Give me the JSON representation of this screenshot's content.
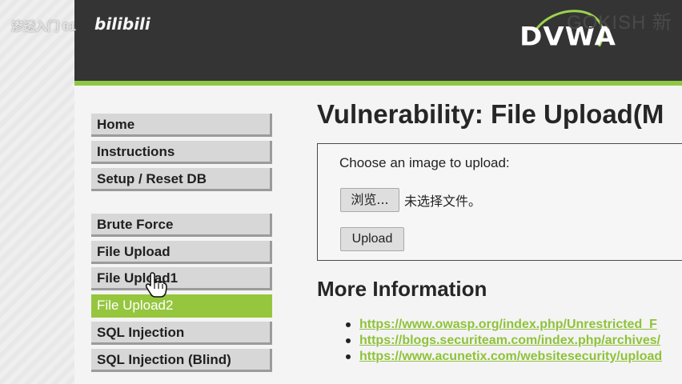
{
  "overlay": {
    "watermark_left": "渗透入门 01",
    "watermark_bilibili": "bilibili",
    "watermark_right": "GOKISH 新"
  },
  "header": {
    "logo_text": "DVWA",
    "brand_color": "#8fc744"
  },
  "menu": {
    "items": [
      {
        "label": "Home"
      },
      {
        "label": "Instructions"
      },
      {
        "label": "Setup / Reset DB"
      },
      {
        "label": "Brute Force"
      },
      {
        "label": "File Upload"
      },
      {
        "label": "File Upload1"
      },
      {
        "label": "File Upload2",
        "selected": true
      },
      {
        "label": "SQL Injection"
      },
      {
        "label": "SQL Injection (Blind)"
      }
    ]
  },
  "main": {
    "title": "Vulnerability: File Upload(M",
    "form": {
      "prompt": "Choose an image to upload:",
      "browse_label": "浏览...",
      "no_file_text": "未选择文件。",
      "upload_label": "Upload"
    },
    "more_info_title": "More Information",
    "links": [
      {
        "text": "https://www.owasp.org/index.php/Unrestricted_F"
      },
      {
        "text": "https://blogs.securiteam.com/index.php/archives/"
      },
      {
        "text": "https://www.acunetix.com/websitesecurity/upload"
      }
    ]
  }
}
